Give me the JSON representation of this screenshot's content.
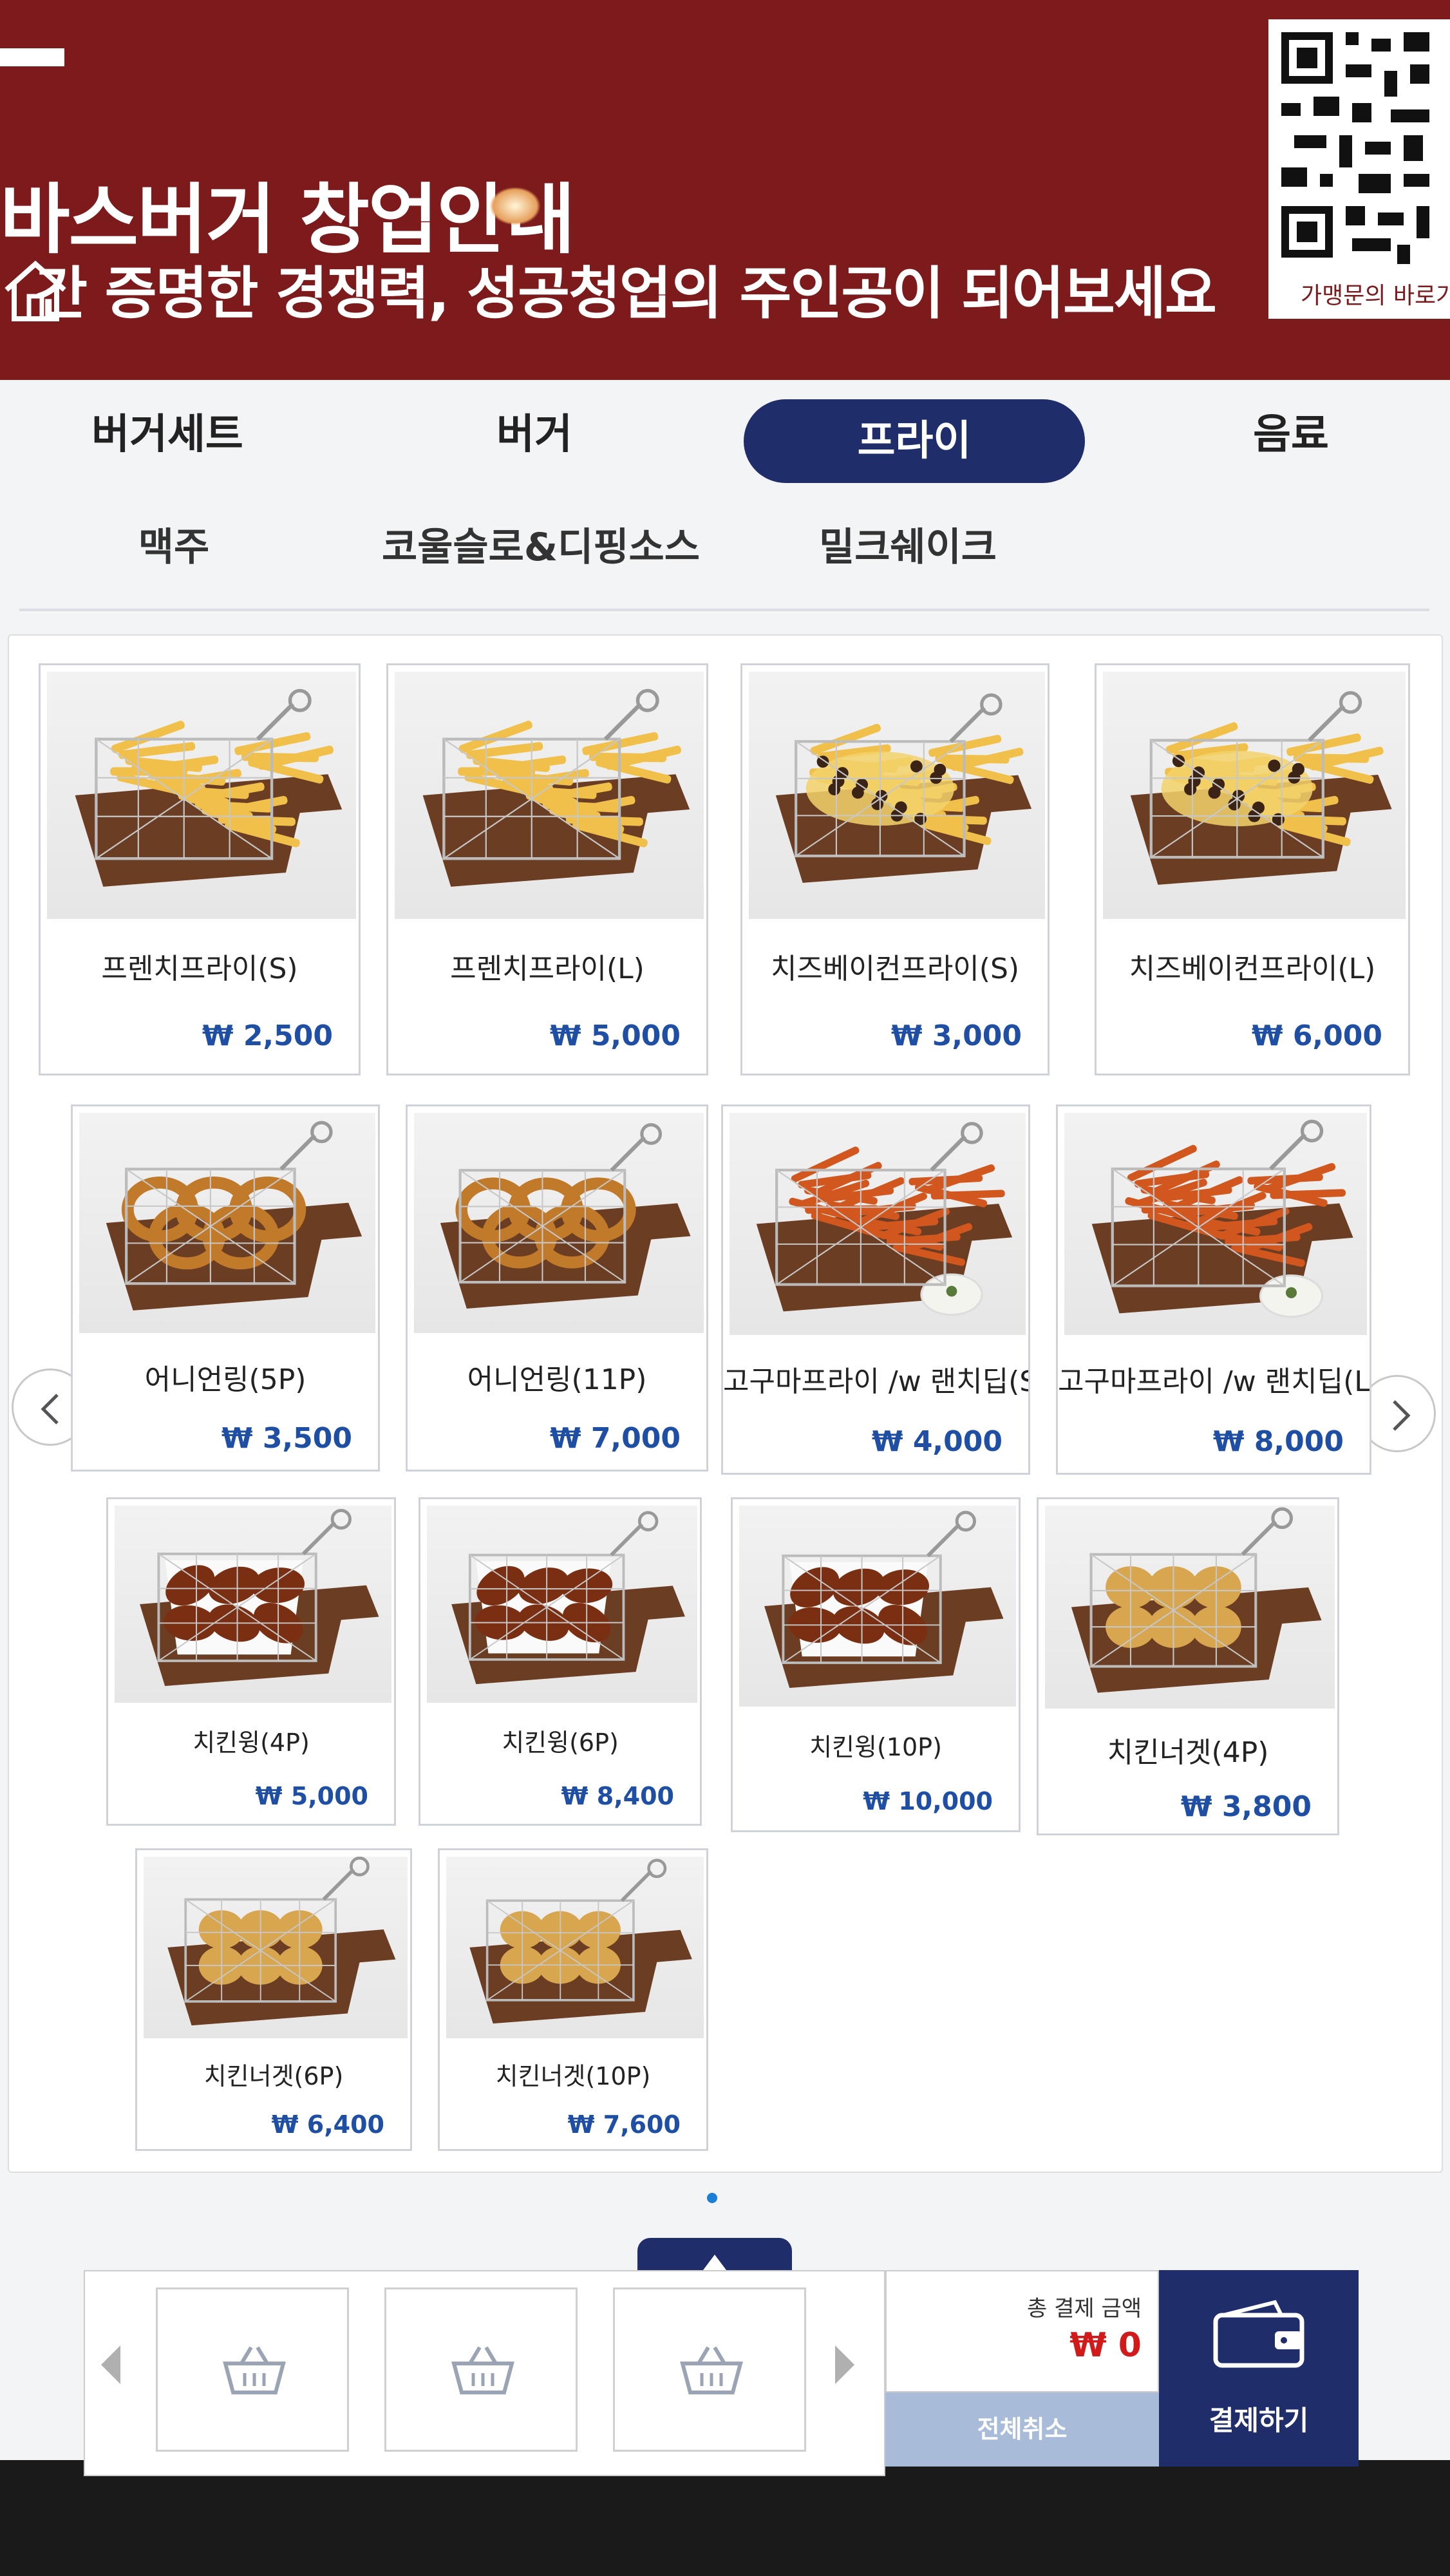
{
  "banner": {
    "title": "바스버거 창업안내",
    "subtitle": "간 증명한 경쟁력, 성공청업의 주인공이 되어보세요",
    "qr_caption": "가맹문의 바로가"
  },
  "categories": {
    "main": [
      "버거세트",
      "버거",
      "프라이",
      "음료"
    ],
    "active": "프라이",
    "sub": [
      "맥주",
      "코울슬로&디핑소스",
      "밀크쉐이크"
    ]
  },
  "products": [
    {
      "name": "프렌치프라이(S)",
      "price": "₩ 2,500",
      "food": "fries"
    },
    {
      "name": "프렌치프라이(L)",
      "price": "₩ 5,000",
      "food": "fries"
    },
    {
      "name": "치즈베이컨프라이(S)",
      "price": "₩ 3,000",
      "food": "cheese-fries"
    },
    {
      "name": "치즈베이컨프라이(L)",
      "price": "₩ 6,000",
      "food": "cheese-fries"
    },
    {
      "name": "어니언링(5P)",
      "price": "₩ 3,500",
      "food": "onion-rings"
    },
    {
      "name": "어니언링(11P)",
      "price": "₩ 7,000",
      "food": "onion-rings"
    },
    {
      "name": "고구마프라이 /w 랜치딥(S)",
      "price": "₩ 4,000",
      "food": "sweet-potato-fries"
    },
    {
      "name": "고구마프라이 /w 랜치딥(L)",
      "price": "₩ 8,000",
      "food": "sweet-potato-fries"
    },
    {
      "name": "치킨윙(4P)",
      "price": "₩ 5,000",
      "food": "chicken-wings"
    },
    {
      "name": "치킨윙(6P)",
      "price": "₩ 8,400",
      "food": "chicken-wings"
    },
    {
      "name": "치킨윙(10P)",
      "price": "₩ 10,000",
      "food": "chicken-wings"
    },
    {
      "name": "치킨너겟(4P)",
      "price": "₩ 3,800",
      "food": "nuggets"
    },
    {
      "name": "치킨너겟(6P)",
      "price": "₩ 6,400",
      "food": "nuggets"
    },
    {
      "name": "치킨너겟(10P)",
      "price": "₩ 7,600",
      "food": "nuggets"
    }
  ],
  "order": {
    "total_label": "총 결제 금액",
    "total_value": "₩ 0",
    "cancel_all": "전체취소",
    "pay": "결제하기"
  },
  "colors": {
    "banner": "#7d1a1c",
    "active_tab": "#1f2d6b",
    "price": "#1f4fa5",
    "total": "#d11a1a"
  },
  "icons": [
    "house-icon",
    "qr-code",
    "chevron-left-icon",
    "chevron-right-icon",
    "basket-icon",
    "wallet-icon",
    "caret-up-icon"
  ]
}
